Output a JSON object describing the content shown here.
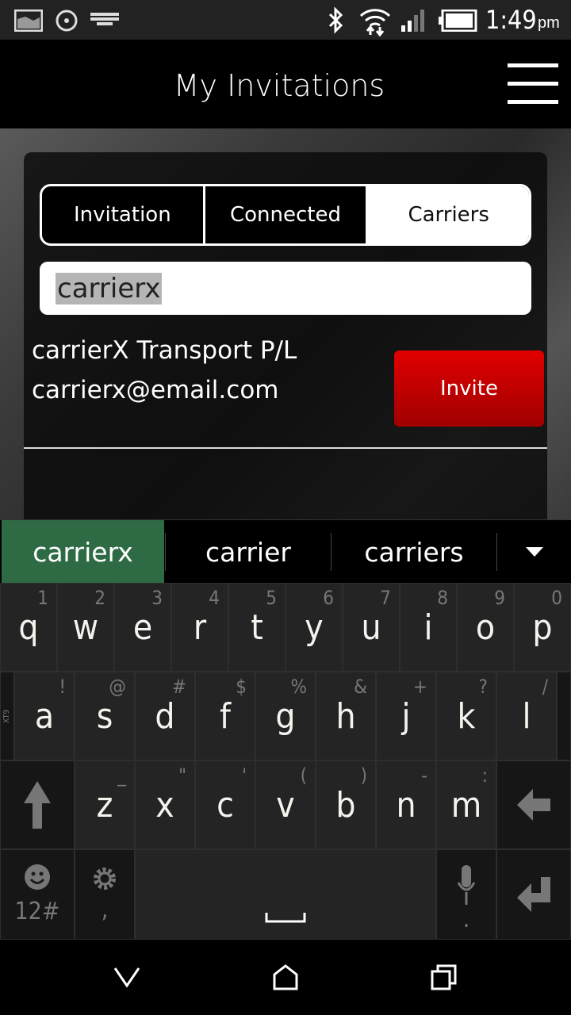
{
  "status_bar": {
    "time": "1:49",
    "ampm": "pm",
    "icons": [
      "image-icon",
      "sync-icon",
      "keyboard-icon",
      "bluetooth-icon",
      "wifi-icon",
      "signal-icon",
      "battery-icon"
    ]
  },
  "header": {
    "title": "My Invitations",
    "menu_icon": "hamburger-icon"
  },
  "tabs": [
    {
      "label": "Invitation"
    },
    {
      "label": "Connected"
    },
    {
      "label": "Carriers",
      "active": true
    }
  ],
  "search": {
    "value": "carrierx"
  },
  "result": {
    "name": "carrierX Transport P/L",
    "email": "carrierx@email.com",
    "button": "Invite"
  },
  "colors": {
    "invite": "#d00000",
    "suggestion_selected": "#2e6b45"
  },
  "suggestions": [
    "carrierx",
    "carrier",
    "carriers"
  ],
  "keyboard": {
    "row1": [
      {
        "k": "q",
        "s": "1"
      },
      {
        "k": "w",
        "s": "2"
      },
      {
        "k": "e",
        "s": "3"
      },
      {
        "k": "r",
        "s": "4"
      },
      {
        "k": "t",
        "s": "5"
      },
      {
        "k": "y",
        "s": "6"
      },
      {
        "k": "u",
        "s": "7"
      },
      {
        "k": "i",
        "s": "8"
      },
      {
        "k": "o",
        "s": "9"
      },
      {
        "k": "p",
        "s": "0"
      }
    ],
    "row2": [
      {
        "k": "a",
        "s": "!"
      },
      {
        "k": "s",
        "s": "@"
      },
      {
        "k": "d",
        "s": "#"
      },
      {
        "k": "f",
        "s": "$"
      },
      {
        "k": "g",
        "s": "%"
      },
      {
        "k": "h",
        "s": "&"
      },
      {
        "k": "j",
        "s": "+"
      },
      {
        "k": "k",
        "s": "?"
      },
      {
        "k": "l",
        "s": "/"
      }
    ],
    "row3": [
      {
        "k": "z",
        "s": "_"
      },
      {
        "k": "x",
        "s": "\""
      },
      {
        "k": "c",
        "s": "'"
      },
      {
        "k": "v",
        "s": "("
      },
      {
        "k": "b",
        "s": ")"
      },
      {
        "k": "n",
        "s": "-"
      },
      {
        "k": "m",
        "s": ":"
      }
    ],
    "xt9": "XT9",
    "sym": "12#",
    "comma": ",",
    "period": "."
  }
}
